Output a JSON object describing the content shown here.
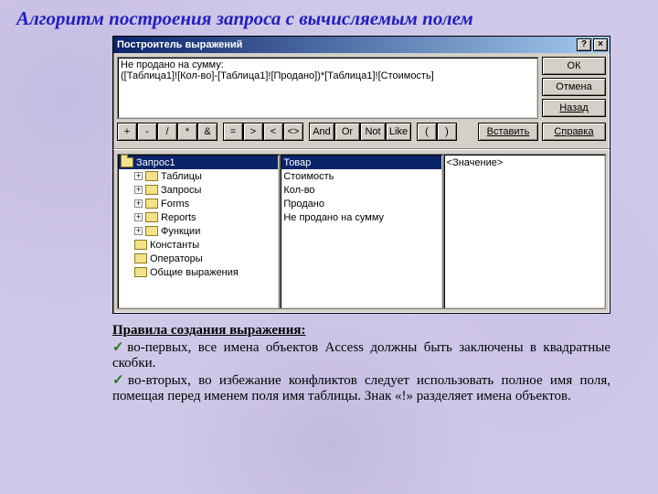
{
  "page": {
    "title": "Алгоритм построения запроса с вычисляемым полем"
  },
  "dialog": {
    "title": "Построитель выражений",
    "help_glyph": "?",
    "close_glyph": "×",
    "expression": {
      "line1": "Не продано на сумму:",
      "line2": "([Таблица1]![Кол-во]-[Таблица1]![Продано])*[Таблица1]![Стоимость]"
    },
    "buttons": {
      "ok": "ОК",
      "cancel": "Отмена",
      "back": "Назад",
      "insert": "Вставить",
      "help": "Справка"
    },
    "operators": [
      "+",
      "-",
      "/",
      "*",
      "&",
      "=",
      ">",
      "<",
      "<>",
      "And",
      "Or",
      "Not",
      "Like",
      "(",
      ")"
    ],
    "tree": [
      {
        "label": "Запрос1",
        "icon": "folder-open",
        "selected": true,
        "expand": false,
        "indent": 0
      },
      {
        "label": "Таблицы",
        "icon": "folder",
        "expand": true,
        "indent": 1
      },
      {
        "label": "Запросы",
        "icon": "folder",
        "expand": true,
        "indent": 1
      },
      {
        "label": "Forms",
        "icon": "folder",
        "expand": true,
        "indent": 1
      },
      {
        "label": "Reports",
        "icon": "folder",
        "expand": true,
        "indent": 1
      },
      {
        "label": "Функции",
        "icon": "folder",
        "expand": true,
        "indent": 1
      },
      {
        "label": "Константы",
        "icon": "folder",
        "expand": false,
        "indent": 1
      },
      {
        "label": "Операторы",
        "icon": "folder",
        "expand": false,
        "indent": 1
      },
      {
        "label": "Общие выражения",
        "icon": "folder",
        "expand": false,
        "indent": 1
      }
    ],
    "fields": [
      {
        "label": "Товар",
        "selected": true
      },
      {
        "label": "Стоимость"
      },
      {
        "label": "Кол-во"
      },
      {
        "label": "Продано"
      },
      {
        "label": "Не продано на сумму"
      }
    ],
    "values": [
      {
        "label": "<Значение>"
      }
    ]
  },
  "rules": {
    "heading": "Правила создания выражения:",
    "item1": "во-первых, все имена объектов Access должны быть заключены в квадратные скобки.",
    "item2": "во-вторых, во избежание конфликтов следует использовать полное имя поля, помещая перед именем поля имя таблицы. Знак «!» разделяет имена объектов."
  }
}
